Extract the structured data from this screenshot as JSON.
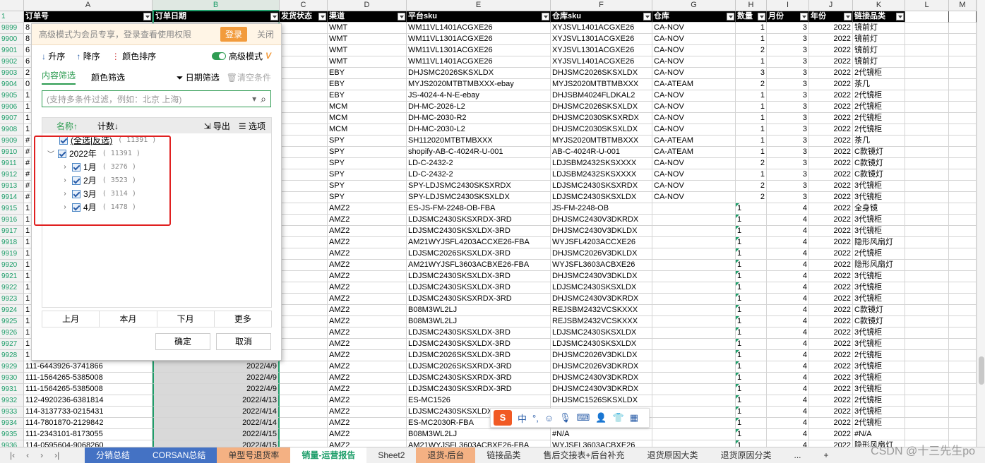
{
  "columns": [
    "A",
    "B",
    "C",
    "D",
    "E",
    "F",
    "G",
    "H",
    "I",
    "J",
    "K",
    "L",
    "M"
  ],
  "header_row_number": "1",
  "headers": [
    "订单号",
    "订单日期",
    "发货状态",
    "渠道",
    "平台sku",
    "仓库sku",
    "仓库",
    "数量",
    "月份",
    "年份",
    "链接品类"
  ],
  "rows": [
    {
      "rn": "9899",
      "a": "8",
      "b": "",
      "d": "WMT",
      "e": "WM11VL1401ACGXE26",
      "f": "XYJSVL1401ACGXE26",
      "g": "CA-NOV",
      "h": "1",
      "i": "3",
      "j": "2022",
      "k": "镜前灯"
    },
    {
      "rn": "9900",
      "a": "8",
      "b": "",
      "d": "WMT",
      "e": "WM11VL1301ACGXE26",
      "f": "XYJSVL1301ACGXE26",
      "g": "CA-NOV",
      "h": "1",
      "i": "3",
      "j": "2022",
      "k": "镜前灯"
    },
    {
      "rn": "9901",
      "a": "6",
      "b": "",
      "d": "WMT",
      "e": "WM11VL1301ACGXE26",
      "f": "XYJSVL1301ACGXE26",
      "g": "CA-NOV",
      "h": "2",
      "i": "3",
      "j": "2022",
      "k": "镜前灯"
    },
    {
      "rn": "9902",
      "a": "6",
      "b": "",
      "d": "WMT",
      "e": "WM11VL1401ACGXE26",
      "f": "XYJSVL1401ACGXE26",
      "g": "CA-NOV",
      "h": "1",
      "i": "3",
      "j": "2022",
      "k": "镜前灯"
    },
    {
      "rn": "9903",
      "a": "2",
      "b": "",
      "d": "EBY",
      "e": "DHJSMC2026SKSXLDX",
      "f": "DHJSMC2026SKSXLDX",
      "g": "CA-NOV",
      "h": "3",
      "i": "3",
      "j": "2022",
      "k": "2代镜柜"
    },
    {
      "rn": "9904",
      "a": "0",
      "b": "",
      "d": "EBY",
      "e": "MYJS2020MTBTMBXXX-ebay",
      "f": "MYJS2020MTBTMBXXX",
      "g": "CA-ATEAM",
      "h": "2",
      "i": "3",
      "j": "2022",
      "k": "茶几"
    },
    {
      "rn": "9905",
      "a": "1",
      "b": "",
      "d": "EBY",
      "e": "JS-4024-4-N-E-ebay",
      "f": "DHJSBM4024FLDKAL2",
      "g": "CA-NOV",
      "h": "1",
      "i": "3",
      "j": "2022",
      "k": "2代镜柜"
    },
    {
      "rn": "9906",
      "a": "1",
      "b": "",
      "d": "MCM",
      "e": "DH-MC-2026-L2",
      "f": "DHJSMC2026SKSXLDX",
      "g": "CA-NOV",
      "h": "1",
      "i": "3",
      "j": "2022",
      "k": "2代镜柜"
    },
    {
      "rn": "9907",
      "a": "1",
      "b": "",
      "d": "MCM",
      "e": "DH-MC-2030-R2",
      "f": "DHJSMC2030SKSXRDX",
      "g": "CA-NOV",
      "h": "1",
      "i": "3",
      "j": "2022",
      "k": "2代镜柜"
    },
    {
      "rn": "9908",
      "a": "1",
      "b": "",
      "d": "MCM",
      "e": "DH-MC-2030-L2",
      "f": "DHJSMC2030SKSXLDX",
      "g": "CA-NOV",
      "h": "1",
      "i": "3",
      "j": "2022",
      "k": "2代镜柜"
    },
    {
      "rn": "9909",
      "a": "#",
      "b": "",
      "d": "SPY",
      "e": "SH112020MTBTMBXXX",
      "f": "MYJS2020MTBTMBXXX",
      "g": "CA-ATEAM",
      "h": "1",
      "i": "3",
      "j": "2022",
      "k": "茶几"
    },
    {
      "rn": "9910",
      "a": "#",
      "b": "",
      "d": "SPY",
      "e": "shopify-AB-C-4024R-U-001",
      "f": "AB-C-4024R-U-001",
      "g": "CA-ATEAM",
      "h": "1",
      "i": "3",
      "j": "2022",
      "k": "C款镜灯"
    },
    {
      "rn": "9911",
      "a": "#",
      "b": "",
      "d": "SPY",
      "e": "LD-C-2432-2",
      "f": "LDJSBM2432SKSXXXX",
      "g": "CA-NOV",
      "h": "2",
      "i": "3",
      "j": "2022",
      "k": "C款镜灯"
    },
    {
      "rn": "9912",
      "a": "#",
      "b": "",
      "d": "SPY",
      "e": "LD-C-2432-2",
      "f": "LDJSBM2432SKSXXXX",
      "g": "CA-NOV",
      "h": "1",
      "i": "3",
      "j": "2022",
      "k": "C款镜灯"
    },
    {
      "rn": "9913",
      "a": "#",
      "b": "",
      "d": "SPY",
      "e": "SPY-LDJSMC2430SKSXRDX",
      "f": "LDJSMC2430SKSXRDX",
      "g": "CA-NOV",
      "h": "2",
      "i": "3",
      "j": "2022",
      "k": "3代镜柜"
    },
    {
      "rn": "9914",
      "a": "#",
      "b": "",
      "d": "SPY",
      "e": "SPY-LDJSMC2430SKSXLDX",
      "f": "LDJSMC2430SKSXLDX",
      "g": "CA-NOV",
      "h": "2",
      "i": "3",
      "j": "2022",
      "k": "3代镜柜"
    },
    {
      "rn": "9915",
      "a": "1",
      "b": "",
      "d": "AMZ2",
      "e": "ES-JS-FM-2248-OB-FBA",
      "f": "JS-FM-2248-OB",
      "g": "",
      "h": "1",
      "i": "4",
      "j": "2022",
      "k": "全身镜"
    },
    {
      "rn": "9916",
      "a": "1",
      "b": "",
      "d": "AMZ2",
      "e": "LDJSMC2430SKSXRDX-3RD",
      "f": "DHJSMC2430V3DKRDX",
      "g": "",
      "h": "1",
      "i": "4",
      "j": "2022",
      "k": "3代镜柜"
    },
    {
      "rn": "9917",
      "a": "1",
      "b": "",
      "d": "AMZ2",
      "e": "LDJSMC2430SKSXLDX-3RD",
      "f": "DHJSMC2430V3DKLDX",
      "g": "",
      "h": "1",
      "i": "4",
      "j": "2022",
      "k": "3代镜柜"
    },
    {
      "rn": "9918",
      "a": "1",
      "b": "",
      "d": "AMZ2",
      "e": "AM21WYJSFL4203ACCXE26-FBA",
      "f": "WYJSFL4203ACCXE26",
      "g": "",
      "h": "1",
      "i": "4",
      "j": "2022",
      "k": "隐形风扇灯"
    },
    {
      "rn": "9919",
      "a": "1",
      "b": "",
      "d": "AMZ2",
      "e": "LDJSMC2026SKSXLDX-3RD",
      "f": "DHJSMC2026V3DKLDX",
      "g": "",
      "h": "1",
      "i": "4",
      "j": "2022",
      "k": "2代镜柜"
    },
    {
      "rn": "9920",
      "a": "1",
      "b": "",
      "d": "AMZ2",
      "e": "AM21WYJSFL3603ACBXE26-FBA",
      "f": "WYJSFL3603ACBXE26",
      "g": "",
      "h": "1",
      "i": "4",
      "j": "2022",
      "k": "隐形风扇灯"
    },
    {
      "rn": "9921",
      "a": "1",
      "b": "",
      "d": "AMZ2",
      "e": "LDJSMC2430SKSXLDX-3RD",
      "f": "DHJSMC2430V3DKLDX",
      "g": "",
      "h": "1",
      "i": "4",
      "j": "2022",
      "k": "3代镜柜"
    },
    {
      "rn": "9922",
      "a": "1",
      "b": "",
      "d": "AMZ2",
      "e": "LDJSMC2430SKSXLDX-3RD",
      "f": "LDJSMC2430SKSXLDX",
      "g": "",
      "h": "1",
      "i": "4",
      "j": "2022",
      "k": "3代镜柜"
    },
    {
      "rn": "9923",
      "a": "1",
      "b": "",
      "d": "AMZ2",
      "e": "LDJSMC2430SKSXRDX-3RD",
      "f": "DHJSMC2430V3DKRDX",
      "g": "",
      "h": "1",
      "i": "4",
      "j": "2022",
      "k": "3代镜柜"
    },
    {
      "rn": "9924",
      "a": "1",
      "b": "",
      "d": "AMZ2",
      "e": "B08M3WL2LJ",
      "f": "REJSBM2432VCSKXXX",
      "g": "",
      "h": "1",
      "i": "4",
      "j": "2022",
      "k": "C款镜灯"
    },
    {
      "rn": "9925",
      "a": "1",
      "b": "",
      "d": "AMZ2",
      "e": "B08M3WL2LJ",
      "f": "REJSBM2432VCSKXXX",
      "g": "",
      "h": "1",
      "i": "4",
      "j": "2022",
      "k": "C款镜灯"
    },
    {
      "rn": "9926",
      "a": "1",
      "b": "",
      "d": "AMZ2",
      "e": "LDJSMC2430SKSXLDX-3RD",
      "f": "LDJSMC2430SKSXLDX",
      "g": "",
      "h": "1",
      "i": "4",
      "j": "2022",
      "k": "3代镜柜"
    },
    {
      "rn": "9927",
      "a": "1",
      "b": "",
      "d": "AMZ2",
      "e": "LDJSMC2430SKSXLDX-3RD",
      "f": "LDJSMC2430SKSXLDX",
      "g": "",
      "h": "1",
      "i": "4",
      "j": "2022",
      "k": "3代镜柜"
    },
    {
      "rn": "9928",
      "a": "1",
      "b": "",
      "d": "AMZ2",
      "e": "LDJSMC2026SKSXLDX-3RD",
      "f": "DHJSMC2026V3DKLDX",
      "g": "",
      "h": "1",
      "i": "4",
      "j": "2022",
      "k": "2代镜柜"
    },
    {
      "rn": "9929",
      "a": "111-6443926-3741866",
      "b": "2022/4/9",
      "d": "AMZ2",
      "e": "LDJSMC2026SKSXRDX-3RD",
      "f": "DHJSMC2026V3DKRDX",
      "g": "",
      "h": "1",
      "i": "4",
      "j": "2022",
      "k": "3代镜柜"
    },
    {
      "rn": "9930",
      "a": "111-1564265-5385008",
      "b": "2022/4/9",
      "d": "AMZ2",
      "e": "LDJSMC2430SKSXRDX-3RD",
      "f": "DHJSMC2430V3DKRDX",
      "g": "",
      "h": "1",
      "i": "4",
      "j": "2022",
      "k": "3代镜柜"
    },
    {
      "rn": "9931",
      "a": "111-1564265-5385008",
      "b": "2022/4/9",
      "d": "AMZ2",
      "e": "LDJSMC2430SKSXRDX-3RD",
      "f": "DHJSMC2430V3DKRDX",
      "g": "",
      "h": "1",
      "i": "4",
      "j": "2022",
      "k": "3代镜柜"
    },
    {
      "rn": "9932",
      "a": "112-4920236-6381814",
      "b": "2022/4/13",
      "d": "AMZ2",
      "e": "ES-MC1526",
      "f": "DHJSMC1526SKSXLDX",
      "g": "",
      "h": "1",
      "i": "4",
      "j": "2022",
      "k": "2代镜柜"
    },
    {
      "rn": "9933",
      "a": "114-3137733-0215431",
      "b": "2022/4/14",
      "d": "AMZ2",
      "e": "LDJSMC2430SKSXLDX-3RD",
      "f": "",
      "g": "",
      "h": "1",
      "i": "4",
      "j": "2022",
      "k": "3代镜柜"
    },
    {
      "rn": "9934",
      "a": "114-7801870-2129842",
      "b": "2022/4/14",
      "d": "AMZ2",
      "e": "ES-MC2030R-FBA",
      "f": "",
      "g": "",
      "h": "1",
      "i": "4",
      "j": "2022",
      "k": "2代镜柜"
    },
    {
      "rn": "9935",
      "a": "111-2343101-8173055",
      "b": "2022/4/15",
      "d": "AMZ2",
      "e": "B08M3WL2LJ",
      "f": "#N/A",
      "g": "",
      "h": "1",
      "i": "4",
      "j": "2022",
      "k": "#N/A"
    },
    {
      "rn": "9936",
      "a": "114-0595604-9068260",
      "b": "2022/4/15",
      "d": "AMZ2",
      "e": "AM21WYJSFL3603ACBXE26-FBA",
      "f": "WYJSFL3603ACBXE26",
      "g": "",
      "h": "1",
      "i": "4",
      "j": "2022",
      "k": "隐形风扇灯"
    }
  ],
  "filter_panel": {
    "banner_text": "高级模式为会员专享，登录查看使用权限",
    "login": "登录",
    "close": "关闭",
    "sort_asc": "升序",
    "sort_desc": "降序",
    "color_sort": "颜色排序",
    "advanced_mode": "高级模式",
    "tab_content": "内容筛选",
    "tab_color": "颜色筛选",
    "date_filter": "日期筛选",
    "clear": "清空条件",
    "search_placeholder": "(支持多条件过滤，例如：北京  上海)",
    "col_name": "名称↑",
    "col_count": "计数↓",
    "export": "导出",
    "options": "选项",
    "select_all": "(全选|反选)",
    "select_all_count": "( 11391 )",
    "year": "2022年",
    "year_count": "( 11391 )",
    "months": [
      {
        "label": "1月",
        "count": "( 3276 )"
      },
      {
        "label": "2月",
        "count": "( 3523 )"
      },
      {
        "label": "3月",
        "count": "( 3114 )"
      },
      {
        "label": "4月",
        "count": "( 1478 )"
      }
    ],
    "quick": [
      "上月",
      "本月",
      "下月",
      "更多"
    ],
    "ok": "确定",
    "cancel": "取消"
  },
  "sheet_tabs": [
    {
      "label": "分销总结",
      "style": "blue"
    },
    {
      "label": "CORSAN总结",
      "style": "blue"
    },
    {
      "label": "单型号退货率",
      "style": "orange"
    },
    {
      "label": "销量-运营报告",
      "style": "active"
    },
    {
      "label": "Sheet2",
      "style": "plain"
    },
    {
      "label": "退货-后台",
      "style": "orange"
    },
    {
      "label": "链接品类",
      "style": "plain"
    },
    {
      "label": "售后交接表+后台补充",
      "style": "plain"
    },
    {
      "label": "退货原因大类",
      "style": "plain"
    },
    {
      "label": "退货原因分类",
      "style": "plain"
    },
    {
      "label": "...",
      "style": "plain"
    },
    {
      "label": "+",
      "style": "plain"
    }
  ],
  "watermark": "CSDN @十三先生po",
  "ime_label": "中"
}
